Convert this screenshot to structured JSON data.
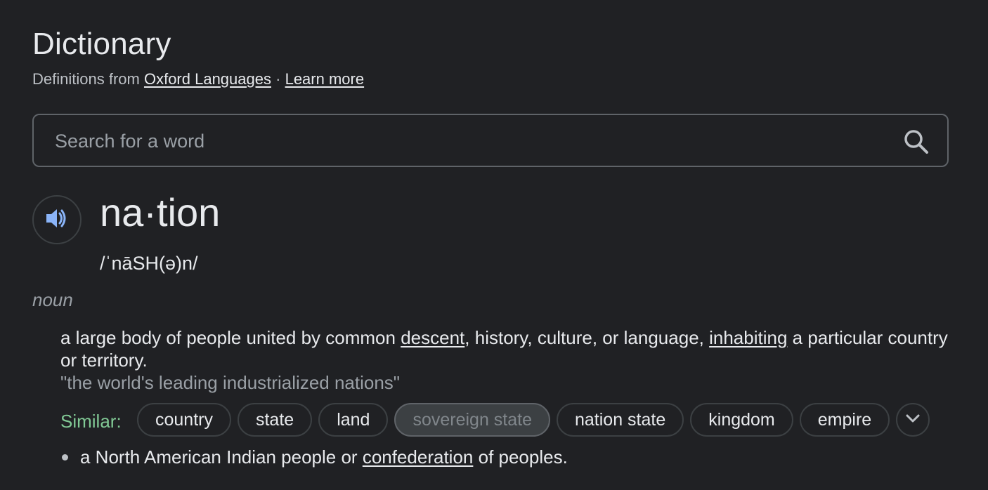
{
  "header": {
    "title": "Dictionary",
    "source_prefix": "Definitions from",
    "source_link": "Oxford Languages",
    "separator": "·",
    "learn_more": "Learn more"
  },
  "search": {
    "placeholder": "Search for a word"
  },
  "entry": {
    "word": "na·tion",
    "phonetic": "/ˈnāSH(ə)n/",
    "part_of_speech": "noun",
    "definitions": [
      {
        "text_1": "a large body of people united by common ",
        "link_1": "descent",
        "text_2": ", history, culture, or language, ",
        "link_2": "inhabiting",
        "text_3": " a particular country or territory.",
        "example": "\"the world's leading industrialized nations\"",
        "similar_label": "Similar:",
        "similar": [
          "country",
          "state",
          "land",
          "sovereign state",
          "nation state",
          "kingdom",
          "empire"
        ]
      },
      {
        "text_1": "a North American Indian people or ",
        "link_1": "confederation",
        "text_2": " of peoples."
      }
    ]
  },
  "icons": {
    "speaker": "volume-up-icon",
    "search": "search-icon",
    "more": "chevron-down-icon"
  },
  "colors": {
    "background": "#202124",
    "accent_speaker": "#8ab4f8",
    "similar_label": "#81c995"
  }
}
